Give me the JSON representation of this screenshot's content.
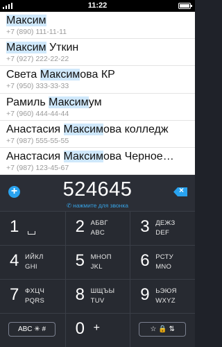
{
  "status_bar": {
    "time": "11:22"
  },
  "contacts": [
    {
      "name_prefix": "",
      "name_match": "Максим",
      "name_suffix": "",
      "phone": "+7 (890) 111-11-11"
    },
    {
      "name_prefix": "",
      "name_match": "Максим",
      "name_suffix": " Уткин",
      "phone": "+7 (927) 222-22-22"
    },
    {
      "name_prefix": "Света ",
      "name_match": "Максим",
      "name_suffix": "ова КР",
      "phone": "+7 (950) 333-33-33"
    },
    {
      "name_prefix": "Рамиль ",
      "name_match": "Максим",
      "name_suffix": "ум",
      "phone": "+7 (960) 444-44-44"
    },
    {
      "name_prefix": "Анастасия ",
      "name_match": "Максим",
      "name_suffix": "ова колледж",
      "phone": "+7 (987) 555-55-55"
    },
    {
      "name_prefix": "Анастасия ",
      "name_match": "Максим",
      "name_suffix": "ова Черное…",
      "phone": "+7 (987) 123-45-67"
    }
  ],
  "dialer": {
    "number": "524645",
    "call_hint": "нажмите для звонка",
    "add_icon": "+",
    "delete_icon": "backspace-icon"
  },
  "keypad": [
    {
      "digit": "1",
      "l1": "",
      "l2": ""
    },
    {
      "digit": "2",
      "l1": "АБВГ",
      "l2": "ABC"
    },
    {
      "digit": "3",
      "l1": "ДЕЖЗ",
      "l2": "DEF"
    },
    {
      "digit": "4",
      "l1": "ИЙКЛ",
      "l2": "GHI"
    },
    {
      "digit": "5",
      "l1": "МНОП",
      "l2": "JKL"
    },
    {
      "digit": "6",
      "l1": "РСТУ",
      "l2": "MNO"
    },
    {
      "digit": "7",
      "l1": "ФХЦЧ",
      "l2": "PQRS"
    },
    {
      "digit": "8",
      "l1": "ШЩЪЫ",
      "l2": "TUV"
    },
    {
      "digit": "9",
      "l1": "ЬЭЮЯ",
      "l2": "WXYZ"
    }
  ],
  "bottom_row": {
    "abc_label": "ABC ✳ #",
    "zero": "0",
    "plus": "+",
    "symbols_label": "☆ 🔒 ⇅"
  }
}
